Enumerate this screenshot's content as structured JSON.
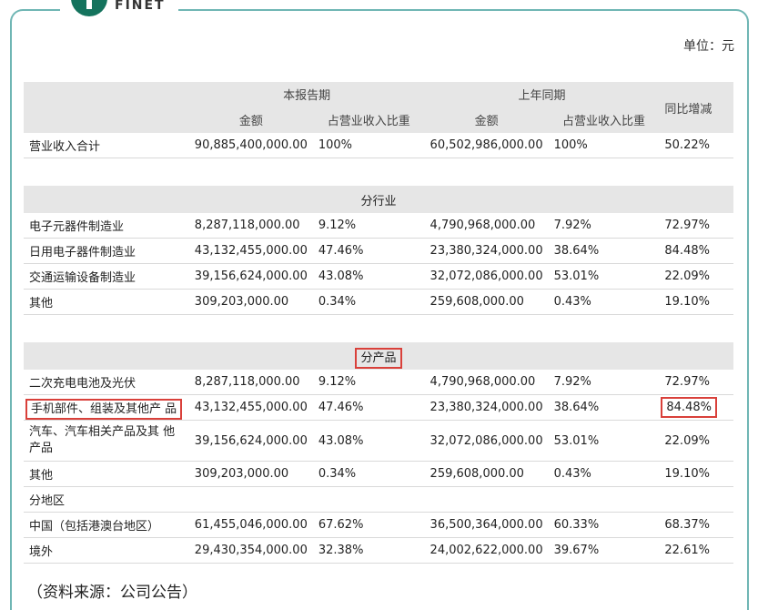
{
  "logo": {
    "text": "FINET"
  },
  "unit": "单位：元",
  "header": {
    "current_period": "本报告期",
    "prior_period": "上年同期",
    "yoy": "同比增减",
    "amount": "金额",
    "ratio": "占营业收入比重"
  },
  "total": {
    "label": "营业收入合计",
    "cur": "90,885,400,000.00",
    "cur_pct": "100%",
    "prev": "60,502,986,000.00",
    "prev_pct": "100%",
    "yoy": "50.22%"
  },
  "sections": {
    "industry": "分行业",
    "product": "分产品",
    "region": "分地区"
  },
  "industry_rows": [
    {
      "label": "电子元器件制造业",
      "cur": "8,287,118,000.00",
      "cur_pct": "9.12%",
      "prev": "4,790,968,000.00",
      "prev_pct": "7.92%",
      "yoy": "72.97%"
    },
    {
      "label": "日用电子器件制造业",
      "cur": "43,132,455,000.00",
      "cur_pct": "47.46%",
      "prev": "23,380,324,000.00",
      "prev_pct": "38.64%",
      "yoy": "84.48%"
    },
    {
      "label": "交通运输设备制造业",
      "cur": "39,156,624,000.00",
      "cur_pct": "43.08%",
      "prev": "32,072,086,000.00",
      "prev_pct": "53.01%",
      "yoy": "22.09%"
    },
    {
      "label": "其他",
      "cur": "309,203,000.00",
      "cur_pct": "0.34%",
      "prev": "259,608,000.00",
      "prev_pct": "0.43%",
      "yoy": "19.10%"
    }
  ],
  "product_rows": [
    {
      "label": "二次充电电池及光伏",
      "cur": "8,287,118,000.00",
      "cur_pct": "9.12%",
      "prev": "4,790,968,000.00",
      "prev_pct": "7.92%",
      "yoy": "72.97%"
    },
    {
      "label": "手机部件、组装及其他产 品",
      "cur": "43,132,455,000.00",
      "cur_pct": "47.46%",
      "prev": "23,380,324,000.00",
      "prev_pct": "38.64%",
      "yoy": "84.48%"
    },
    {
      "label": "汽车、汽车相关产品及其 他产品",
      "cur": "39,156,624,000.00",
      "cur_pct": "43.08%",
      "prev": "32,072,086,000.00",
      "prev_pct": "53.01%",
      "yoy": "22.09%"
    },
    {
      "label": "其他",
      "cur": "309,203,000.00",
      "cur_pct": "0.34%",
      "prev": "259,608,000.00",
      "prev_pct": "0.43%",
      "yoy": "19.10%"
    }
  ],
  "region_rows": [
    {
      "label": "中国（包括港澳台地区）",
      "cur": "61,455,046,000.00",
      "cur_pct": "67.62%",
      "prev": "36,500,364,000.00",
      "prev_pct": "60.33%",
      "yoy": "68.37%"
    },
    {
      "label": "境外",
      "cur": "29,430,354,000.00",
      "cur_pct": "32.38%",
      "prev": "24,002,622,000.00",
      "prev_pct": "39.67%",
      "yoy": "22.61%"
    }
  ],
  "source": "（资料来源：公司公告）"
}
